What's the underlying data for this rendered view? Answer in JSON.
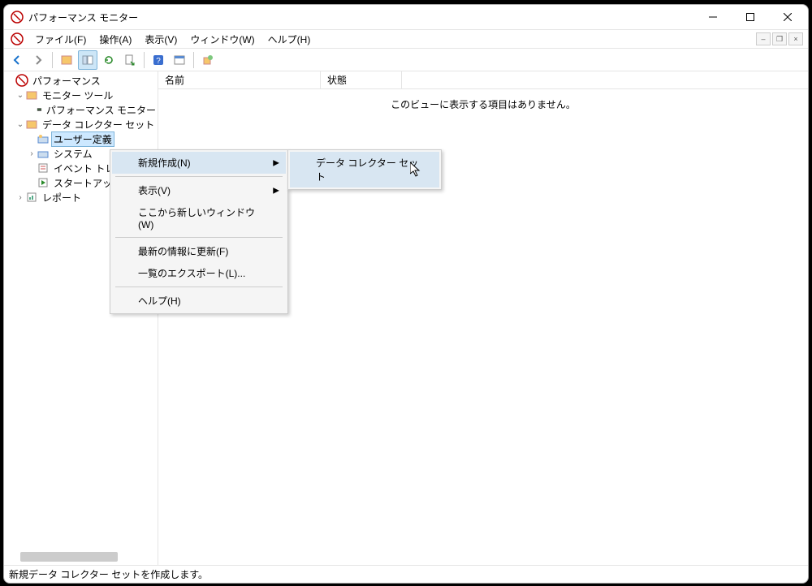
{
  "window": {
    "title": "パフォーマンス モニター"
  },
  "menu": {
    "file": "ファイル(F)",
    "action": "操作(A)",
    "view": "表示(V)",
    "window": "ウィンドウ(W)",
    "help": "ヘルプ(H)"
  },
  "tree": {
    "root": "パフォーマンス",
    "monitorTools": "モニター ツール",
    "perfMonitor": "パフォーマンス モニター",
    "dcs": "データ コレクター セット",
    "userDefined": "ユーザー定義",
    "system": "システム",
    "eventTrace": "イベント トレ",
    "startup": "スタートアップ",
    "reports": "レポート"
  },
  "list": {
    "colName": "名前",
    "colStatus": "状態",
    "empty": "このビューに表示する項目はありません。"
  },
  "ctx": {
    "new": "新規作成(N)",
    "view": "表示(V)",
    "newWindow": "ここから新しいウィンドウ(W)",
    "refresh": "最新の情報に更新(F)",
    "export": "一覧のエクスポート(L)...",
    "help": "ヘルプ(H)",
    "subDcs": "データ コレクター セット"
  },
  "status": "新規データ コレクター セットを作成します。"
}
